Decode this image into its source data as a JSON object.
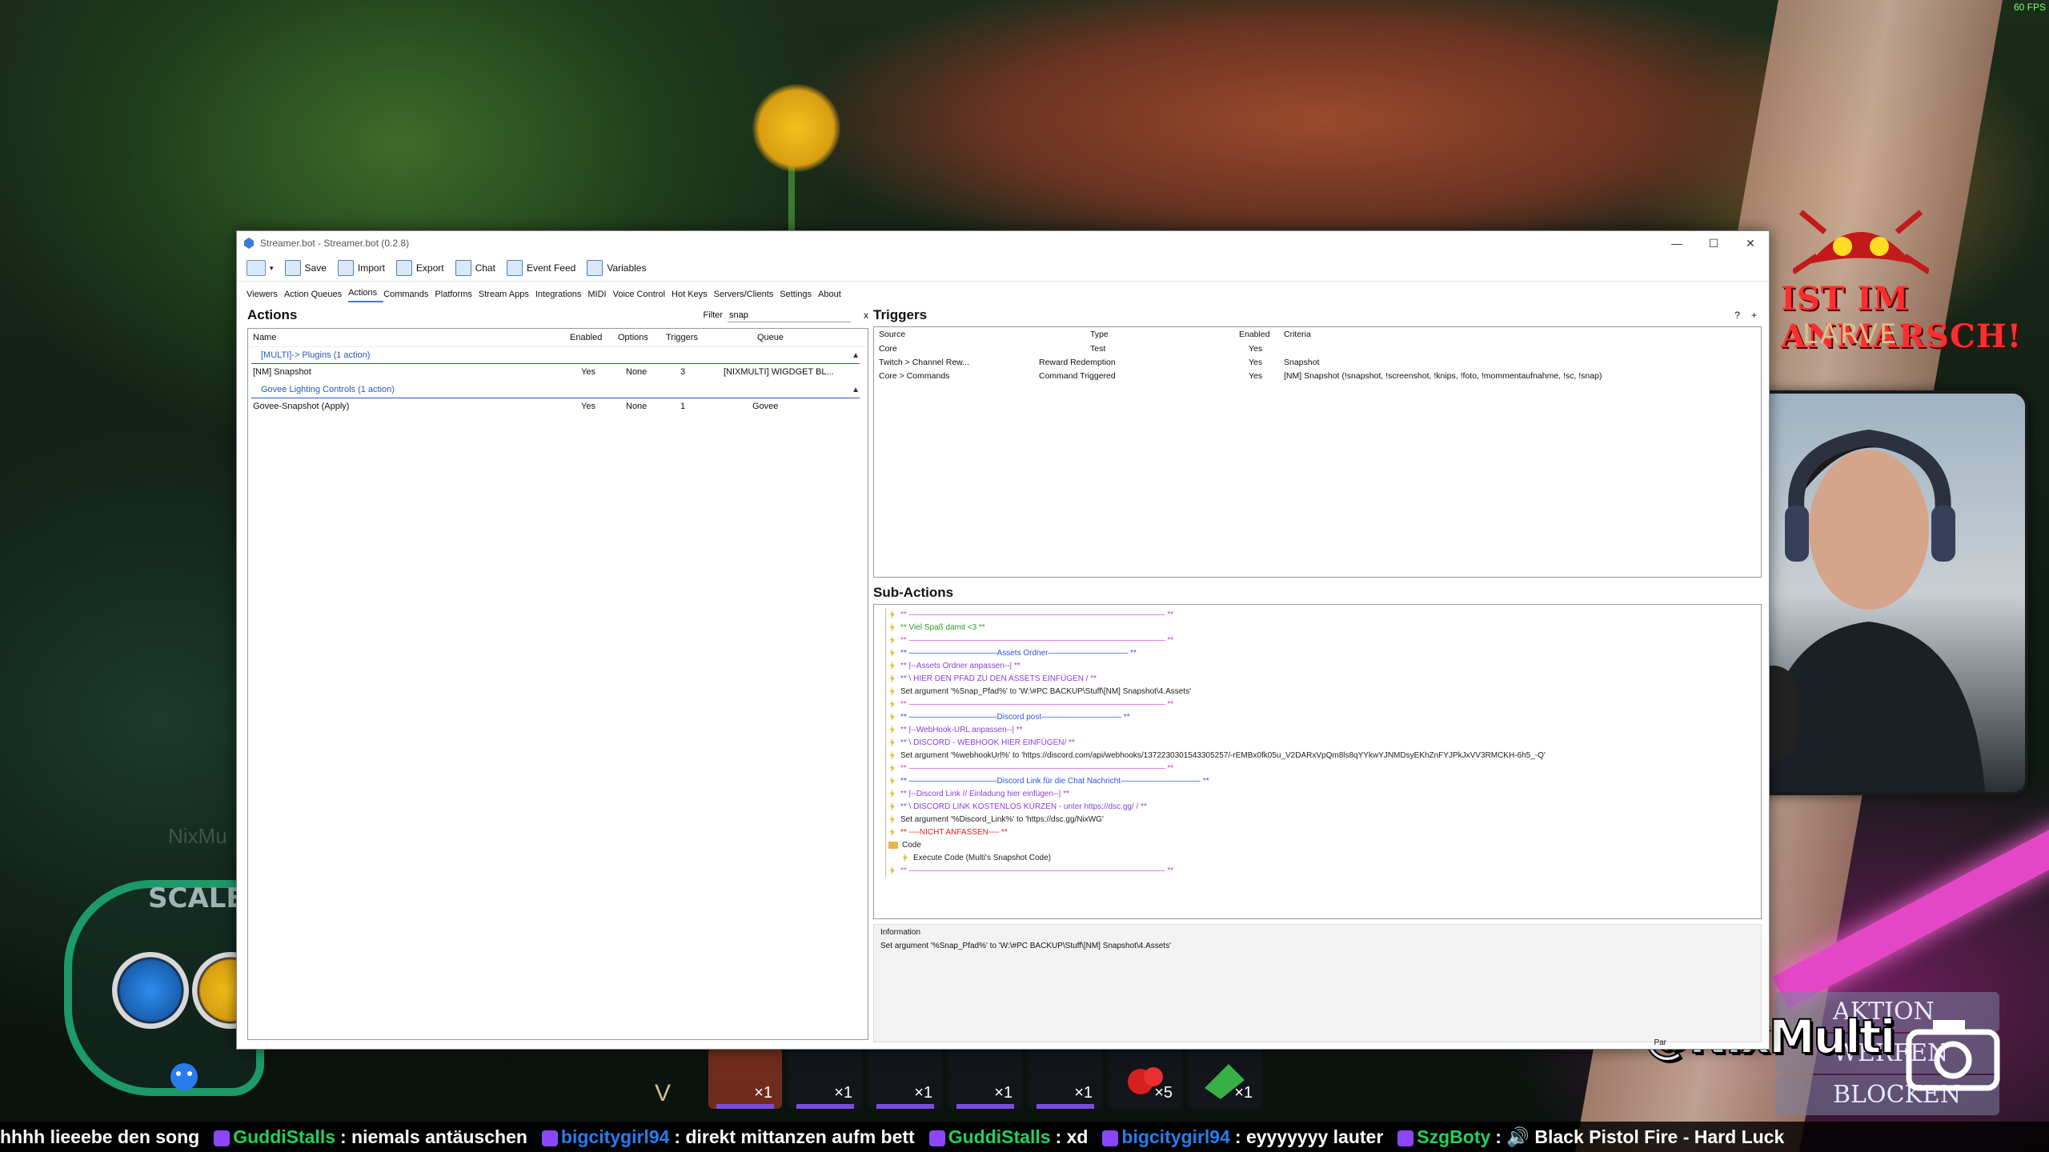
{
  "fps": "60 FPS",
  "window": {
    "title": "Streamer.bot - Streamer.bot (0.2.8)",
    "controls": [
      "—",
      "☐",
      "✕"
    ],
    "toolbar": [
      {
        "label": "",
        "icon": "menu-icon"
      },
      {
        "label": "Save",
        "icon": "save-icon"
      },
      {
        "label": "Import",
        "icon": "import-icon"
      },
      {
        "label": "Export",
        "icon": "export-icon"
      },
      {
        "label": "Chat",
        "icon": "chat-icon"
      },
      {
        "label": "Event Feed",
        "icon": "event-feed-icon"
      },
      {
        "label": "Variables",
        "icon": "variables-icon"
      }
    ],
    "menu": [
      "Viewers",
      "Action Queues",
      "Actions",
      "Commands",
      "Platforms",
      "Stream Apps",
      "Integrations",
      "MIDI",
      "Voice Control",
      "Hot Keys",
      "Servers/Clients",
      "Settings",
      "About"
    ],
    "active_menu": "Actions",
    "actions": {
      "title": "Actions",
      "filter_label": "Filter",
      "filter_value": "snap",
      "filter_clear": "x",
      "columns": [
        "Name",
        "Enabled",
        "Options",
        "Triggers",
        "Queue"
      ],
      "groups": [
        {
          "label": "[MULTI]-> Plugins (1 action)",
          "rows": [
            [
              "[NM] Snapshot",
              "Yes",
              "None",
              "3",
              "[NIXMULTI] WIGDGET BL..."
            ]
          ]
        },
        {
          "label": "Govee Lighting Controls (1 action)",
          "rows": [
            [
              "Govee-Snapshot (Apply)",
              "Yes",
              "None",
              "1",
              "Govee"
            ]
          ]
        }
      ]
    },
    "triggers": {
      "title": "Triggers",
      "help": "?",
      "add": "+",
      "columns": [
        "Source",
        "Type",
        "Enabled",
        "Criteria"
      ],
      "rows": [
        [
          "Core",
          "Test",
          "Yes",
          ""
        ],
        [
          "Twitch > Channel Rew...",
          "Reward Redemption",
          "Yes",
          "Snapshot"
        ],
        [
          "Core > Commands",
          "Command Triggered",
          "Yes",
          "[NM] Snapshot (!snapshot, !screenshot, !knips, !foto, !mommentaufnahme, !sc, !snap)"
        ]
      ]
    },
    "subactions": {
      "title": "Sub-Actions",
      "lines": [
        {
          "text": "** ———————————————————————————————— **",
          "color": "#d23fd2",
          "indent": 0
        },
        {
          "text": "** Viel Spaß damit <3 **",
          "color": "#2a9a2a",
          "indent": 0
        },
        {
          "text": "** ———————————————————————————————— **",
          "color": "#d23fd2",
          "indent": 0
        },
        {
          "text": "** ———————————Assets Ordner—————————— **",
          "color": "#2a56d8",
          "indent": 0
        },
        {
          "text": "** |--Assets Ordner anpassen--| **",
          "color": "#8a3fd2",
          "indent": 0
        },
        {
          "text": "** \\ HIER DEN PFAD ZU DEN ASSETS EINFÜGEN / **",
          "color": "#8a3fd2",
          "indent": 0
        },
        {
          "text": "Set argument '%Snap_Pfad%' to 'W:\\#PC BACKUP\\Stuff\\[NM] Snapshot\\4.Assets'",
          "color": "#222222",
          "indent": 0
        },
        {
          "text": "** ———————————————————————————————— **",
          "color": "#d23fd2",
          "indent": 0
        },
        {
          "text": "** ———————————Discord post—————————— **",
          "color": "#2a56d8",
          "indent": 0
        },
        {
          "text": "** |--WebHook-URL anpassen--| **",
          "color": "#8a3fd2",
          "indent": 0
        },
        {
          "text": "** \\ DISCORD - WEBHOOK HIER EINFÜGEN/ **",
          "color": "#8a3fd2",
          "indent": 0
        },
        {
          "text": "Set argument '%webhookUrl%' to 'https://discord.com/api/webhooks/1372230301543305257/-rEMBx0fk05u_V2DARxVpQm8ls8qYYkwYJNMDsyEKhZnFYJPkJxVV3RMCKH-6h5_-Q'",
          "color": "#222222",
          "indent": 0
        },
        {
          "text": "** ———————————————————————————————— **",
          "color": "#d23fd2",
          "indent": 0
        },
        {
          "text": "** ———————————Discord Link für die Chat Nachricht—————————— **",
          "color": "#2a56d8",
          "indent": 0
        },
        {
          "text": "** |--Discord Link // Einladung hier einfügen--| **",
          "color": "#8a3fd2",
          "indent": 0
        },
        {
          "text": "** \\ DISCORD LINK KOSTENLOS KÜRZEN - unter https://dsc.gg/ / **",
          "color": "#8a3fd2",
          "indent": 0
        },
        {
          "text": "Set argument '%Discord_Link%' to 'https://dsc.gg/NixWG'",
          "color": "#222222",
          "indent": 0
        },
        {
          "text": "** ----NICHT ANFASSEN---- **",
          "color": "#e02020",
          "indent": 0
        },
        {
          "text": "Code",
          "color": "#222222",
          "indent": 0,
          "folder": true
        },
        {
          "text": "Execute Code (Multi's Snapshot Code)",
          "color": "#222222",
          "indent": 1
        },
        {
          "text": "** ———————————————————————————————— **",
          "color": "#d23fd2",
          "indent": 0
        }
      ]
    },
    "information": {
      "label": "Information",
      "value": "Set argument '%Snap_Pfad%' to 'W:\\#PC BACKUP\\Stuff\\[NM] Snapshot\\4.Assets'"
    },
    "status": "Par"
  },
  "overlay": {
    "alert_title": "IST IM ANMARSCH!",
    "alert_sub": "LARVE",
    "handle": "@NixMulti",
    "reward_blocks": [
      "AKTION",
      "WERFEN",
      "BLOCKEN"
    ],
    "hud_label": "SCALE",
    "watermark": "NixMu"
  },
  "hotbar": [
    {
      "count": "×1"
    },
    {
      "count": "×1"
    },
    {
      "count": "×1"
    },
    {
      "count": "×1"
    },
    {
      "count": "×1"
    },
    {
      "count": "×5"
    },
    {
      "count": "×1"
    }
  ],
  "hotbar_key": "V",
  "ticker": [
    {
      "user": "",
      "msg": "hhhh lieeebe den song",
      "color": "#ffffff"
    },
    {
      "user": "GuddiStalls",
      "msg": ": niemals antäuschen",
      "color": "#24d05a"
    },
    {
      "user": "bigcitygirl94",
      "msg": ": direkt mittanzen aufm bett",
      "color": "#2a7bf0"
    },
    {
      "user": "GuddiStalls",
      "msg": ": xd",
      "color": "#24d05a"
    },
    {
      "user": "bigcitygirl94",
      "msg": ": eyyyyyyy lauter",
      "color": "#2a7bf0"
    },
    {
      "user": "SzgBoty",
      "msg": ": 🔊 Black Pistol Fire - Hard Luck",
      "color": "#24d05a"
    }
  ]
}
